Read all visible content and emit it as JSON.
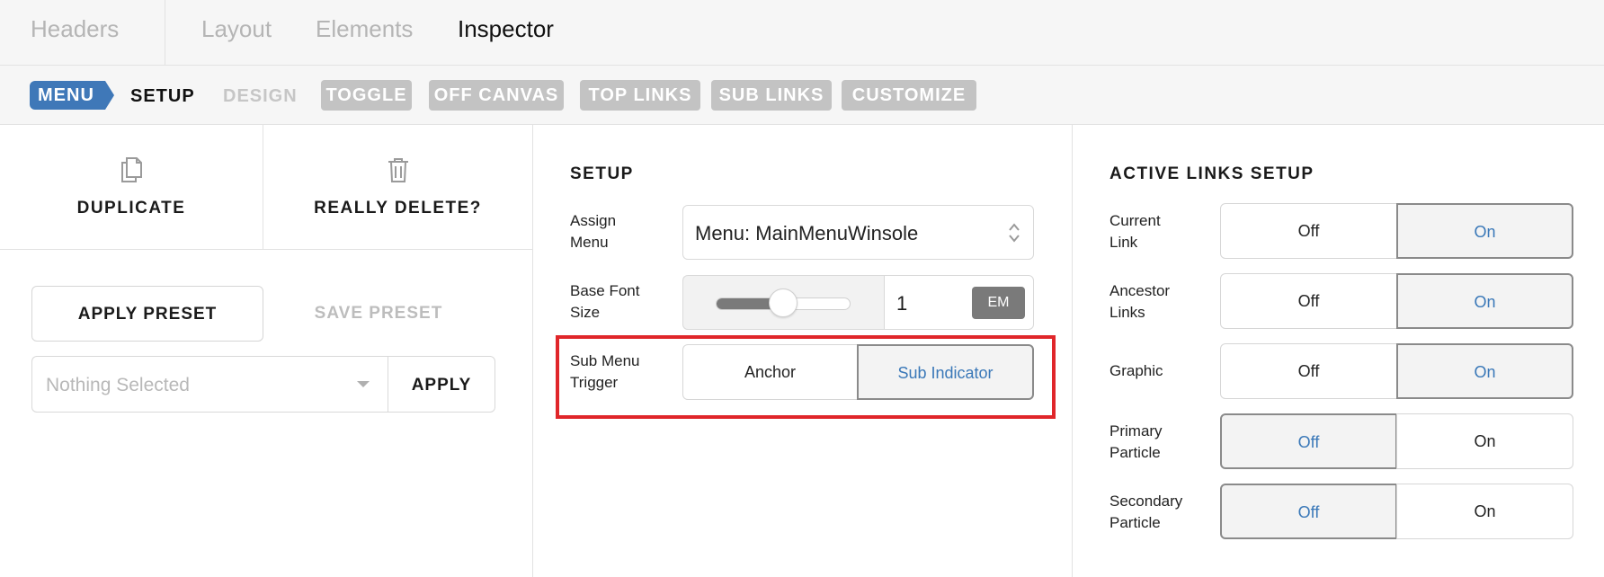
{
  "top_tabs": [
    {
      "label": "Headers",
      "active": false
    },
    {
      "label": "Layout",
      "active": false
    },
    {
      "label": "Elements",
      "active": false
    },
    {
      "label": "Inspector",
      "active": true
    }
  ],
  "breadcrumb": {
    "menu": "MENU",
    "setup": "SETUP",
    "design": "DESIGN",
    "chips": [
      "TOGGLE",
      "OFF CANVAS",
      "TOP LINKS",
      "SUB LINKS",
      "CUSTOMIZE"
    ]
  },
  "actions": {
    "duplicate": "DUPLICATE",
    "delete": "REALLY DELETE?",
    "duplicate_icon": "copy-icon",
    "delete_icon": "trash-icon"
  },
  "presets": {
    "apply_preset": "APPLY PRESET",
    "save_preset": "SAVE PRESET",
    "select_placeholder": "Nothing Selected",
    "apply": "APPLY"
  },
  "setup": {
    "title": "SETUP",
    "assign_menu_label": [
      "Assign",
      "Menu"
    ],
    "assign_menu_value": "Menu: MainMenuWinsole",
    "base_font_label": [
      "Base Font",
      "Size"
    ],
    "base_font_value": "1",
    "base_font_unit": "EM",
    "base_font_slider_fraction": 0.5,
    "sub_menu_label": [
      "Sub Menu",
      "Trigger"
    ],
    "sub_menu_options": [
      "Anchor",
      "Sub Indicator"
    ],
    "sub_menu_selected": "Sub Indicator"
  },
  "active_links": {
    "title": "ACTIVE LINKS SETUP",
    "rows": [
      {
        "label": [
          "Current",
          "Link"
        ],
        "off": "Off",
        "on": "On",
        "selected": "On"
      },
      {
        "label": [
          "Ancestor",
          "Links"
        ],
        "off": "Off",
        "on": "On",
        "selected": "On"
      },
      {
        "label": [
          "Graphic",
          ""
        ],
        "off": "Off",
        "on": "On",
        "selected": "On"
      },
      {
        "label": [
          "Primary",
          "Particle"
        ],
        "off": "Off",
        "on": "On",
        "selected": "Off"
      },
      {
        "label": [
          "Secondary",
          "Particle"
        ],
        "off": "Off",
        "on": "On",
        "selected": "Off"
      }
    ]
  },
  "colors": {
    "accent": "#3f78b8",
    "highlight_box": "#e0262a",
    "chip_bg": "#c3c3c3"
  }
}
